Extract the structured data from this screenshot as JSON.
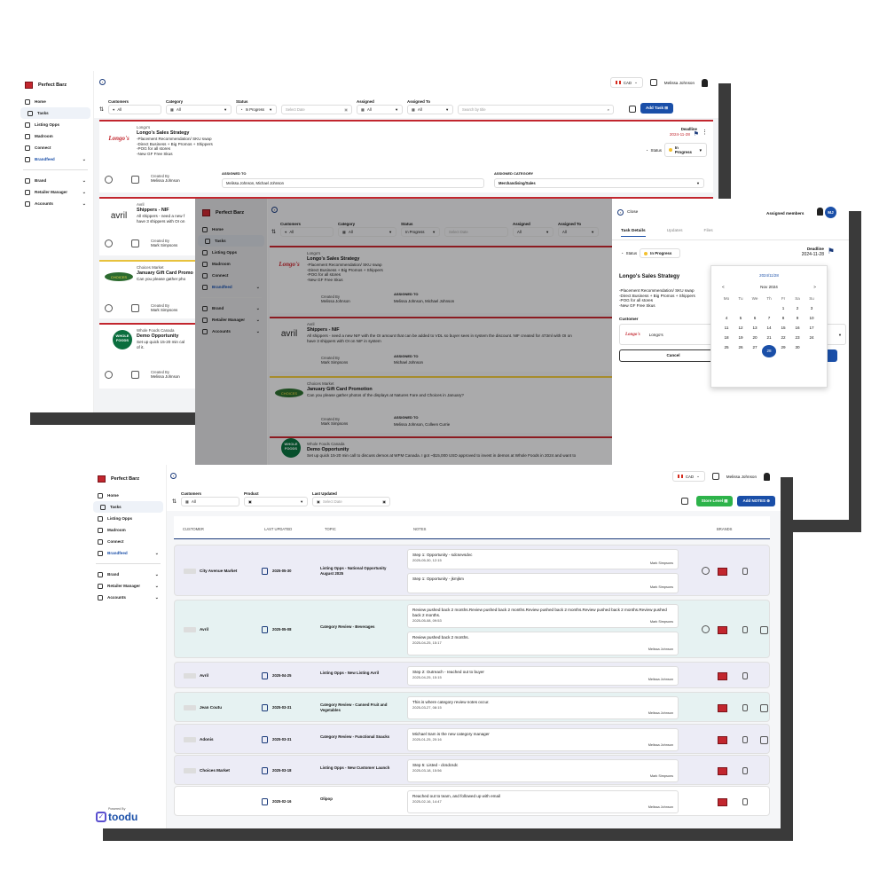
{
  "app": {
    "brand": "Perfect Barz",
    "user": "Melissa Johnson",
    "currency": "CAD"
  },
  "nav": {
    "home": "Home",
    "tasks": "Tasks",
    "listing": "Listing Opps",
    "madroom": "Madroom",
    "connect": "Connect",
    "brandfeed": "Brandfeed",
    "brand": "Brand",
    "retailer": "Retailer Manager",
    "accounts": "Accounts"
  },
  "tasks": {
    "filters": {
      "customers": "Customers",
      "customers_val": "All",
      "category": "Category",
      "category_val": "All",
      "status": "Status",
      "status_val": "In Progress",
      "date_ph": "Select Date",
      "assigned": "Assigned",
      "assigned_val": "All",
      "assigned_to": "Assigned To",
      "assigned_to_val": "All",
      "search_ph": "Search by title",
      "add_task": "Add Task"
    },
    "cards": [
      {
        "customer": "Longo's",
        "title": "Longo's Sales Strategy",
        "desc": "-Placement Recommendation/ SKU swap\n-Direct Business + Big Promos + Shippers\n-POG for all stores\n-New GF Free Skus",
        "deadline_label": "Deadline",
        "deadline": "2024-11-28",
        "status_label": "Status",
        "status": "In Progress",
        "created_by_label": "Created By",
        "created_by": "Melissa Johnson",
        "assigned_to_label": "ASSIGNED TO",
        "assigned_to": "Melissa Johnson, Michael Johnson",
        "assigned_cat_label": "ASSIGNED CATEGORY",
        "assigned_cat": "Merchandising/Sales",
        "logo": "Longo's"
      },
      {
        "customer": "Avril",
        "title": "Shippers - NIF",
        "desc": "All shippers - need a new f\nhave 3 shippers with OI on",
        "created_by_label": "Created By",
        "created_by": "Mark Simpsons",
        "logo": "avril"
      },
      {
        "customer": "Choices Market",
        "title": "January Gift Card Promo",
        "desc": "Can you please gather pho",
        "created_by_label": "Created By",
        "created_by": "Mark Simpsons",
        "logo": "CHOICES"
      },
      {
        "customer": "Whole Foods Canada",
        "title": "Demo Opportunity",
        "desc": "Set up quick 15-20 min cal\nof it.",
        "created_by_label": "Created By",
        "created_by": "Melissa Johnson",
        "logo": "WHOLE FOODS"
      }
    ]
  },
  "detail": {
    "close": "Close",
    "assigned_members": "Assigned members",
    "member_initials": "MJ",
    "tabs": [
      "Task Details",
      "Updates",
      "Files"
    ],
    "status_label": "Status",
    "status": "In Progress",
    "deadline_label": "Deadline",
    "deadline": "2024-11-28",
    "title": "Longo's Sales Strategy",
    "desc": "-Placement Recommendation/ SKU swap\n-Direct Business + Big Promos + Shippers\n-POG for all stores\n-New GF Free Skus",
    "customer_label": "Customer",
    "customer": "Longo's",
    "cancel": "Cancel",
    "cal": {
      "selected": "2024/11/28",
      "month": "Nov 2024",
      "prev": "<",
      "next": ">",
      "weekdays": [
        "Mo",
        "Tu",
        "We",
        "Th",
        "Fr",
        "Sa",
        "Su"
      ],
      "days": [
        "",
        "",
        "",
        "",
        "1",
        "2",
        "3",
        "4",
        "5",
        "6",
        "7",
        "8",
        "9",
        "10",
        "11",
        "12",
        "13",
        "14",
        "15",
        "16",
        "17",
        "18",
        "19",
        "20",
        "21",
        "22",
        "23",
        "24",
        "25",
        "26",
        "27",
        "28",
        "29",
        "30",
        ""
      ]
    },
    "bg": {
      "cards": [
        {
          "customer": "Longo's",
          "title": "Longo's Sales Strategy",
          "desc": "-Placement Recommendation/ SKU swap\n-Direct Business + Big Promos + Shippers\n-POG for all stores\n-New GF Free Skus",
          "created_by": "Melissa Johnson",
          "assigned_to": "Melissa Johnson, Michael Johnson"
        },
        {
          "customer": "Avril",
          "title": "Shippers - NIF",
          "desc": "All shippers - need a new NIF with the OI amount that can be added to VDL so buyer sees in system the discount. NIF created for 473ml with OI on\nhave 3 shippers with OI on NIF in system",
          "created_by": "Mark Simpsons",
          "assigned_to": "Michael Johnson"
        },
        {
          "customer": "Choices Market",
          "title": "January Gift Card Promotion",
          "desc": "Can you please gather photos of the displays at Natures Fare and Choices in January?",
          "created_by": "Mark Simpsons",
          "assigned_to": "Melissa Johnson, Colleen Currie"
        },
        {
          "customer": "Whole Foods Canada",
          "title": "Demo Opportunity",
          "desc": "Set up quick 15-20 min call to discuss demos at WFM Canada. I got ~$15,000 USD approved to invest in demos at Whole Foods in 2024 and want to",
          "created_by": "",
          "assigned_to": ""
        }
      ],
      "created_by_label": "Created By",
      "assigned_to_label": "ASSIGNED TO"
    }
  },
  "notes": {
    "filters": {
      "customers": "Customers",
      "customers_val": "All",
      "product": "Product",
      "last_updated": "Last Updated",
      "date_ph": "Select Date",
      "store_level": "Store Level",
      "add_notes": "Add NOTES"
    },
    "headers": {
      "customer": "CUSTOMER",
      "last_updated": "LAST UPDATED",
      "topic": "TOPIC",
      "notes": "NOTES",
      "brands": "BRANDS"
    },
    "rows": [
      {
        "customer": "City Avenue Market",
        "date": "2025-05-30",
        "topic": "Listing Opps - National Opportunity August 2025",
        "notes": [
          {
            "text": "Step 1: Opportunity - sdcsevsdvc",
            "dt": "2025-05-30, 12:15",
            "by": "Mark Simpsons"
          },
          {
            "text": "Step 1: Opportunity - jkmjkm",
            "dt": "",
            "by": "Mark Simpsons"
          }
        ]
      },
      {
        "customer": "Avril",
        "date": "2025-05-08",
        "topic": "Category Review - Beverages",
        "notes": [
          {
            "text": "Review pushed back 2 months.Review pushed back 2 months.Review pushed back 2 months.Review pushed back 2 months.Review pushed back 2 months.",
            "dt": "2025-05-08, 09:53",
            "by": "Mark Simpsons"
          },
          {
            "text": "Review pushed back 2 months.",
            "dt": "2025-04-25, 15:17",
            "by": "Melissa Johnson"
          }
        ]
      },
      {
        "customer": "Avril",
        "date": "2025-04-25",
        "topic": "Listing Opps - New Listing Avril",
        "notes": [
          {
            "text": "Step 2: Outreach - reached out to buyer",
            "dt": "2025-04-25, 15:15",
            "by": "Melissa Johnson"
          }
        ]
      },
      {
        "customer": "Jean Coutu",
        "date": "2025-03-31",
        "topic": "Category Review - Canned Fruit and Vegetables",
        "notes": [
          {
            "text": "This is where category review notes occur.",
            "dt": "2025-03-27, 08:15",
            "by": "Melissa Johnson"
          }
        ]
      },
      {
        "customer": "Adonis",
        "date": "2025-03-31",
        "topic": "Category Review - Functional Snacks",
        "notes": [
          {
            "text": "Michael Sam is the new category manager",
            "dt": "2025-01-25, 20:16",
            "by": "Melissa Johnson"
          }
        ]
      },
      {
        "customer": "Choices Market",
        "date": "2025-03-18",
        "topic": "Listing Opps - New Customer Launch",
        "notes": [
          {
            "text": "Step 5: Listed - dcsdcsdc",
            "dt": "2025-03-18, 15:56",
            "by": "Mark Simpsons"
          }
        ]
      },
      {
        "customer": "",
        "date": "2025-02-16",
        "topic": "Olipop",
        "notes": [
          {
            "text": "Reached out to team, and followed up with email",
            "dt": "2025-02-16, 14:47",
            "by": "Melissa Johnson"
          }
        ]
      }
    ],
    "powered": "Powered By",
    "toodu": "toodu"
  }
}
